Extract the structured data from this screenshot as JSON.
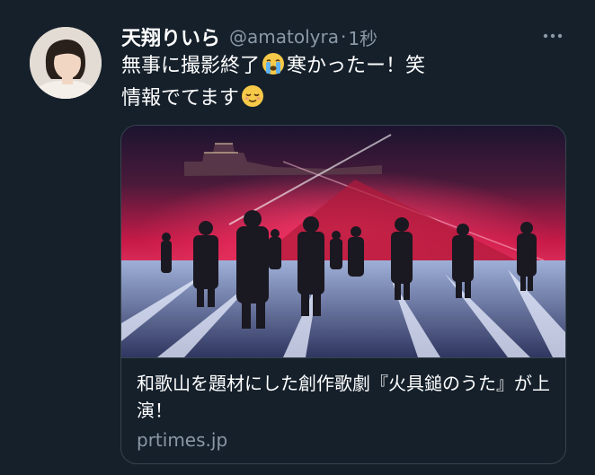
{
  "tweet": {
    "display_name": "天翔りいら",
    "handle": "@amatolyra",
    "separator": "·",
    "time": "1秒",
    "text_line1_a": "無事に撮影終了",
    "text_line1_b": "寒かったー！笑",
    "text_line2": "情報でてます",
    "emoji_1": "crying-face",
    "emoji_2": "relieved-face"
  },
  "card": {
    "title": "和歌山を題材にした創作歌劇『火具鎚のうた』が上演！",
    "domain": "prtimes.jp"
  },
  "colors": {
    "background": "#15202b",
    "secondary_text": "#8b98a5",
    "border": "#38444d"
  }
}
